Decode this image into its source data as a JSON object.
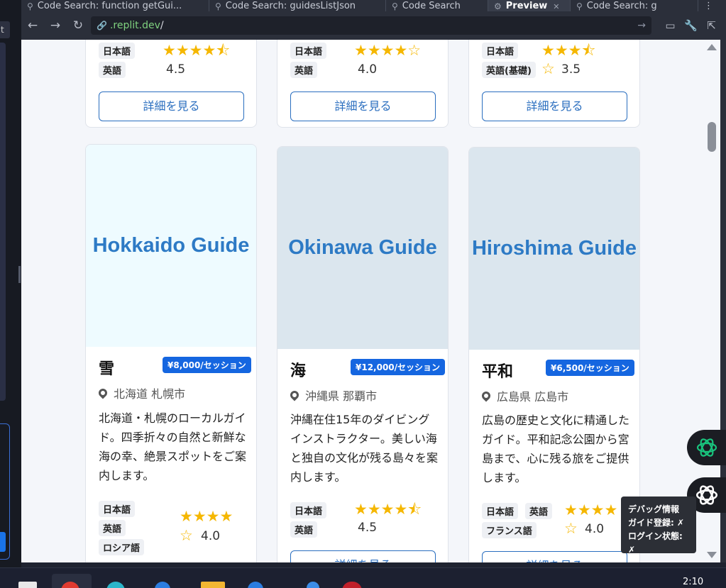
{
  "browser": {
    "tabs": [
      {
        "label": "Code Search: function getGui..."
      },
      {
        "label": "Code Search: guidesListJson"
      },
      {
        "label": "Code Search"
      },
      {
        "label": "Preview"
      },
      {
        "label": "Code Search: g"
      }
    ],
    "url_host": ".replit.dev",
    "url_path": "/",
    "left_tab_letter": "t"
  },
  "top_cards": [
    {
      "lang1": "日本語",
      "lang2": "英語",
      "stars1": "★★★★⯪",
      "stars2": "",
      "rating": "4.5",
      "button": "詳細を見る"
    },
    {
      "lang1": "日本語",
      "lang2": "英語",
      "stars1": "★★★★☆",
      "stars2": "",
      "rating": "4.0",
      "button": "詳細を見る"
    },
    {
      "lang1": "日本語",
      "lang2": "英語(基礎)",
      "stars1": "★★★⯪",
      "stars2": "☆",
      "rating": "3.5",
      "button": "詳細を見る"
    }
  ],
  "guides": [
    {
      "cover_text": "Hokkaido Guide",
      "cover_bg": "#eefbff",
      "name": "雪",
      "price": "¥8,000/セッション",
      "location": "北海道 札幌市",
      "description": "北海道・札幌のローカルガイド。四季折々の自然と新鮮な海の幸、絶景スポットをご案内します。",
      "languages": [
        "日本語",
        "英語",
        "ロシア語"
      ],
      "stars1": "★★★★",
      "stars2": "☆",
      "rating": "4.0"
    },
    {
      "cover_text": "Okinawa Guide",
      "cover_bg": "#dbe6ee",
      "name": "海",
      "price": "¥12,000/セッション",
      "location": "沖縄県 那覇市",
      "description": "沖縄在住15年のダイビングインストラクター。美しい海と独自の文化が残る島々を案内します。",
      "languages": [
        "日本語",
        "英語"
      ],
      "stars1": "★★★★⯪",
      "stars2": "",
      "rating": "4.5",
      "button": "詳細を見る"
    },
    {
      "cover_text": "Hiroshima Guide",
      "cover_bg": "#dbe6ee",
      "name": "平和",
      "price": "¥6,500/セッション",
      "location": "広島県 広島市",
      "description": "広島の歴史と文化に精通したガイド。平和記念公園から宮島まで、心に残る旅をご提供します。",
      "languages": [
        "日本語",
        "英語",
        "フランス語"
      ],
      "stars1": "★★★★",
      "stars2": "☆",
      "rating": "4.0",
      "button": "詳細を見る"
    }
  ],
  "debug": {
    "title": "デバッグ情報",
    "line1": "ガイド登録: ✗",
    "line2": "ログイン状態: ✗"
  },
  "taskbar": {
    "clock": "2:10"
  },
  "colors": {
    "accent": "#1566e0",
    "star": "#f5b700",
    "link": "#2a6ebf"
  }
}
